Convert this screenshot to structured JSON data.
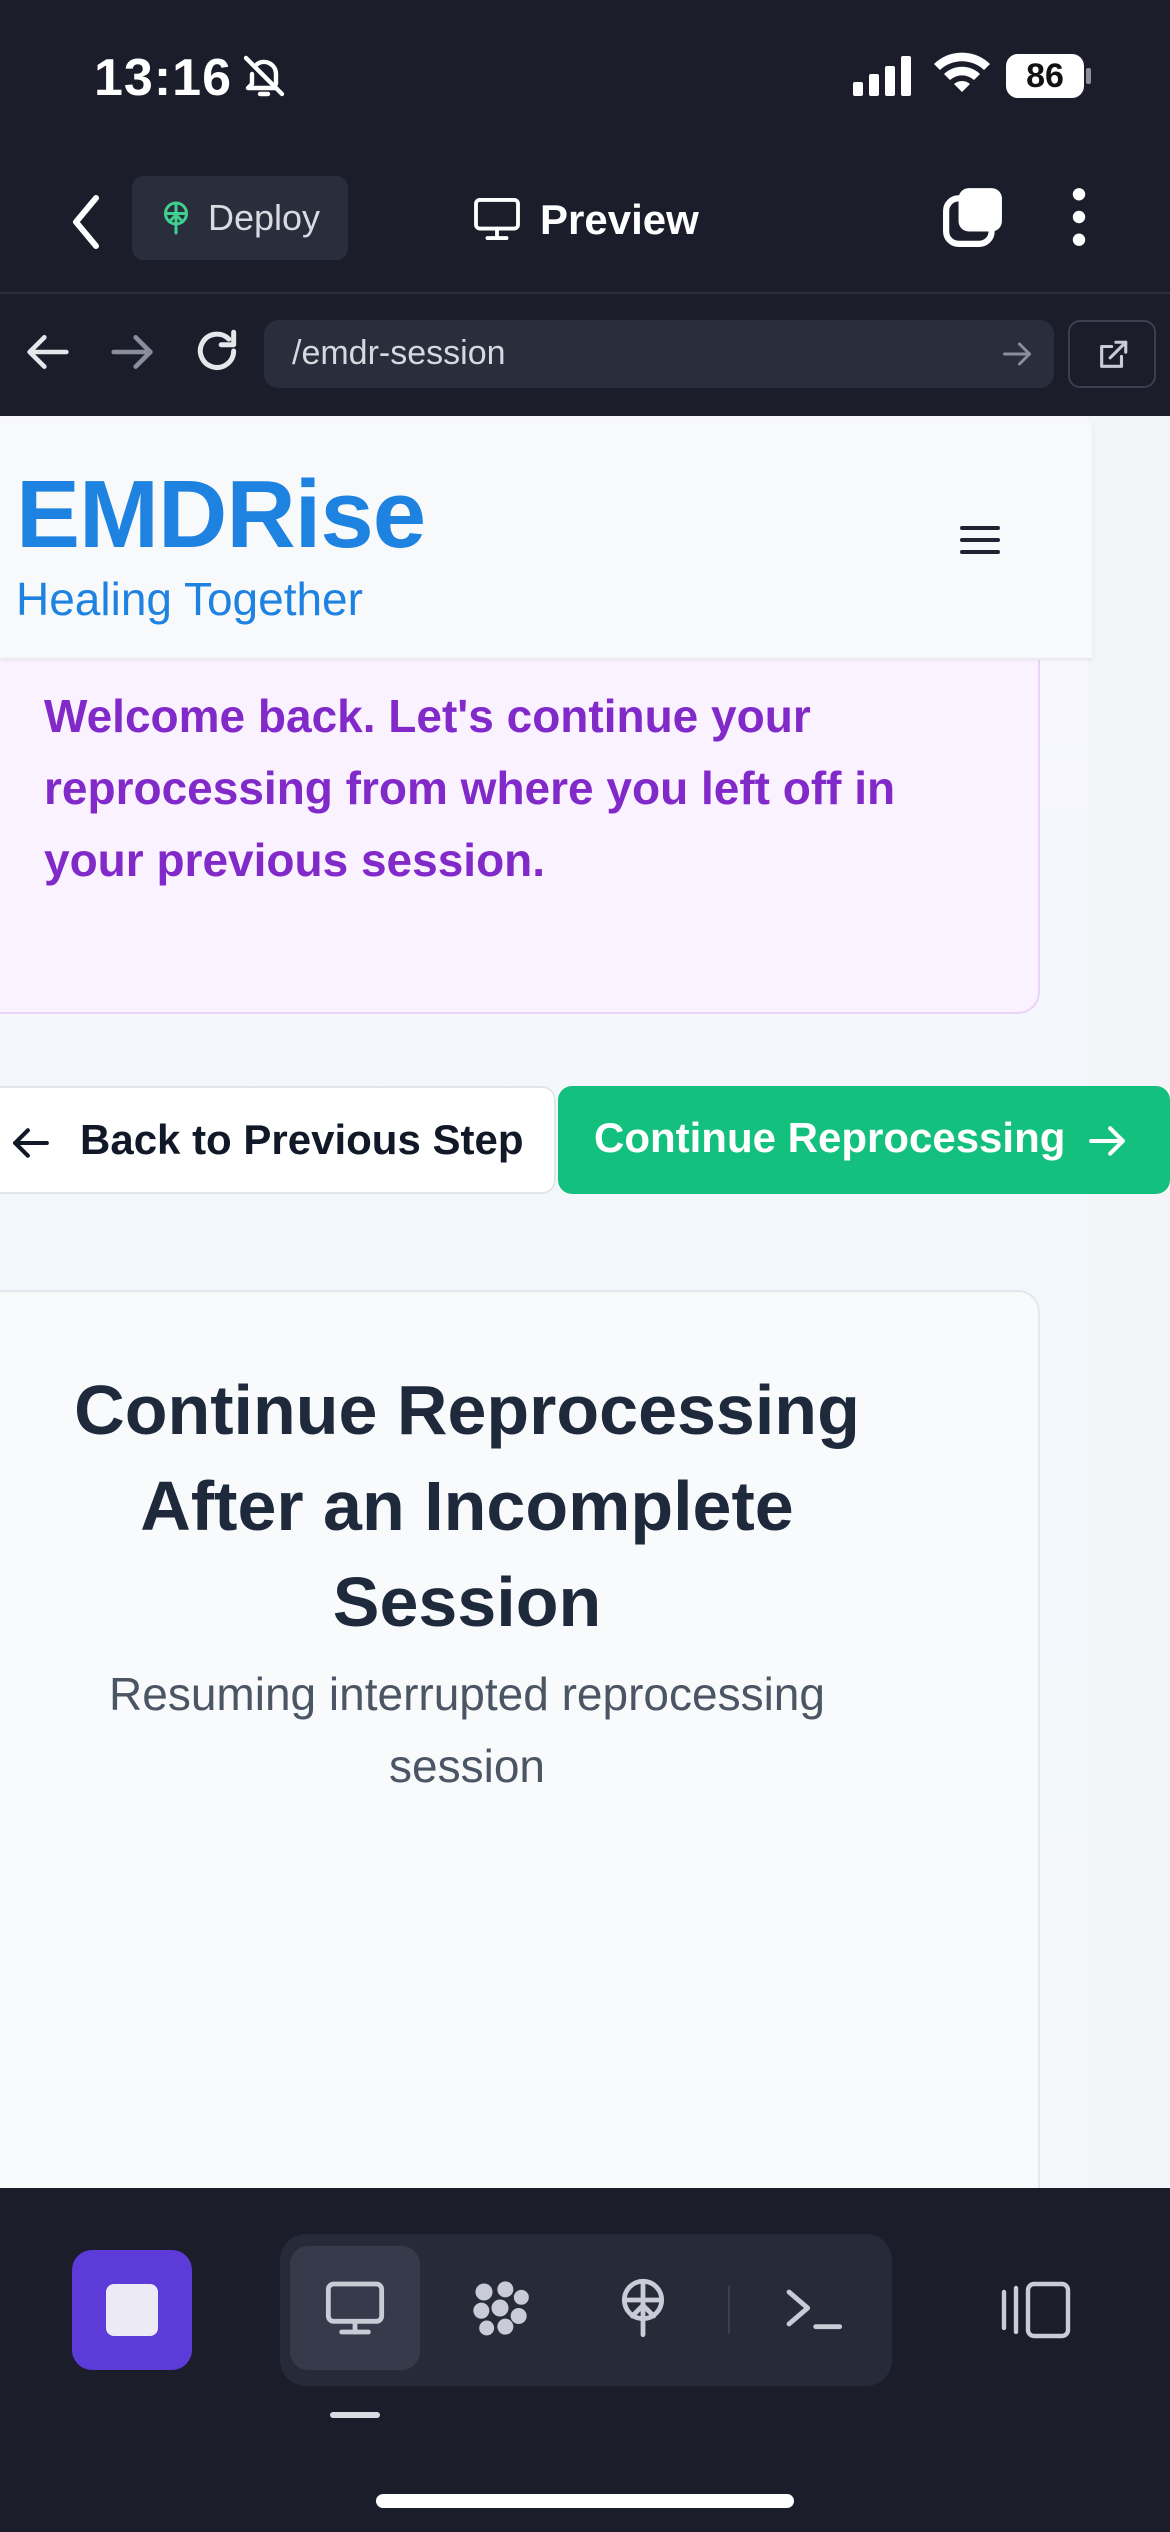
{
  "status_bar": {
    "time": "13:16",
    "battery": "86",
    "icons": [
      "bell-slash-icon",
      "signal-icon",
      "wifi-icon",
      "battery-icon"
    ]
  },
  "app_toolbar": {
    "deploy_label": "Deploy",
    "preview_label": "Preview",
    "icons": [
      "back-chevron-icon",
      "deploy-icon",
      "monitor-icon",
      "tabs-icon",
      "more-vertical-icon"
    ]
  },
  "browser": {
    "url": "/emdr-session",
    "icons": [
      "arrow-left-icon",
      "arrow-right-icon",
      "reload-icon",
      "go-arrow-icon",
      "external-link-icon"
    ]
  },
  "site": {
    "brand": "EMDRise",
    "tagline": "Healing Together",
    "welcome": "Welcome back. Let's continue your reprocessing from where you left off in your previous session.",
    "back_button": "Back to Previous Step",
    "continue_button": "Continue Reprocessing",
    "session_title": "Continue Reprocessing After an Incomplete Session",
    "session_subtitle": "Resuming interrupted reprocessing session"
  },
  "bottom_bar": {
    "tools": [
      "monitor-icon",
      "apps-icon",
      "deploy-icon",
      "terminal-icon"
    ],
    "active_tool": "monitor-icon"
  },
  "colors": {
    "brand_blue": "#1e82e0",
    "welcome_purple": "#8129c9",
    "continue_green": "#14c07d",
    "stop_purple": "#5d3bd9",
    "chrome_dark": "#1b1d2a"
  }
}
